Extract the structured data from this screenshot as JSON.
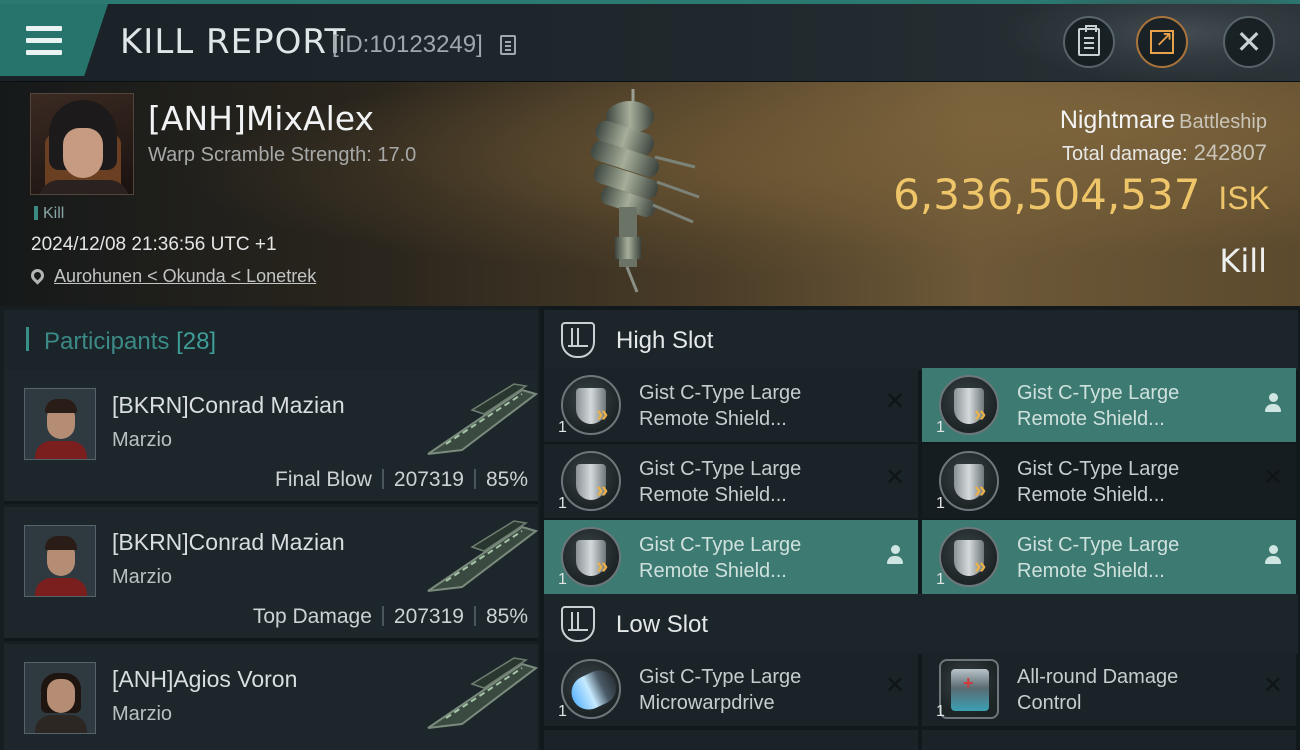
{
  "header": {
    "title": "KILL REPORT",
    "id_text": "[ID:10123249]",
    "icons": [
      "menu-icon",
      "copy-icon",
      "clipboard-icon",
      "share-icon",
      "close-icon"
    ]
  },
  "victim": {
    "name": "[ANH]MixAlex",
    "warp_scramble": "Warp Scramble Strength: 17.0",
    "tag": "Kill",
    "datetime": "2024/12/08 21:36:56 UTC +1",
    "location": "Aurohunen < Okunda < Lonetrek",
    "ship_name": "Nightmare",
    "ship_class": "Battleship",
    "damage_label": "Total damage:",
    "damage_value": "242807",
    "isk_value": "6,336,504,537",
    "isk_unit": "ISK",
    "result": "Kill"
  },
  "participants": {
    "title": "Participants",
    "count": "[28]",
    "rows": [
      {
        "name": "[BKRN]Conrad Mazian",
        "corp": "Marzio",
        "role": "Final Blow",
        "damage": "207319",
        "percent": "85%"
      },
      {
        "name": "[BKRN]Conrad Mazian",
        "corp": "Marzio",
        "role": "Top Damage",
        "damage": "207319",
        "percent": "85%"
      },
      {
        "name": "[ANH]Agios Voron",
        "corp": "Marzio"
      }
    ]
  },
  "slots": {
    "high": {
      "title": "High Slot",
      "modules": [
        {
          "line1": "Gist C-Type Large",
          "line2": "Remote Shield...",
          "qty": "1",
          "status": "destroyed"
        },
        {
          "line1": "Gist C-Type Large",
          "line2": "Remote Shield...",
          "qty": "1",
          "status": "dropped"
        },
        {
          "line1": "Gist C-Type Large",
          "line2": "Remote Shield...",
          "qty": "1",
          "status": "destroyed"
        },
        {
          "line1": "Gist C-Type Large",
          "line2": "Remote Shield...",
          "qty": "1",
          "status": "destroyed"
        },
        {
          "line1": "Gist C-Type Large",
          "line2": "Remote Shield...",
          "qty": "1",
          "status": "dropped"
        },
        {
          "line1": "Gist C-Type Large",
          "line2": "Remote Shield...",
          "qty": "1",
          "status": "dropped"
        }
      ]
    },
    "low": {
      "title": "Low Slot",
      "modules": [
        {
          "line1": "Gist C-Type Large",
          "line2": "Microwarpdrive",
          "qty": "1",
          "status": "destroyed"
        },
        {
          "line1": "All-round Damage",
          "line2": "Control",
          "qty": "1",
          "status": "destroyed"
        }
      ]
    },
    "status_icons": {
      "destroyed": "x-icon",
      "dropped": "person-icon"
    }
  },
  "colors": {
    "accent_teal": "#3d7a71",
    "isk_gold": "#efc56a",
    "menu_tab": "#26746c",
    "panel_dark": "#1a2327"
  }
}
